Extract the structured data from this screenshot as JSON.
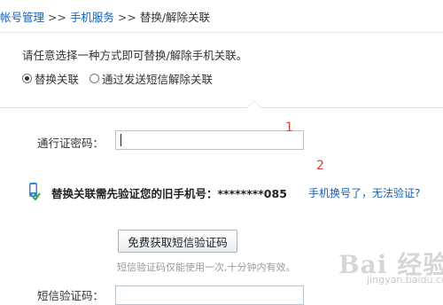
{
  "breadcrumb": {
    "item1": "帐号管理",
    "sep1": " >> ",
    "item2": "手机服务",
    "sep2": " >> ",
    "current": "替换/解除关联"
  },
  "intro": "请任意选择一种方式即可替换/解除手机关联。",
  "options": [
    {
      "label": "替换关联",
      "checked": true
    },
    {
      "label": "通过发送短信解除关联",
      "checked": false
    }
  ],
  "form": {
    "password_label": "通行证密码：",
    "password_value": "",
    "verify_prefix": "替换关联需先验证您的旧手机号：",
    "verify_number": "********085",
    "changed_link": "手机换号了，无法验证?",
    "sms_button": "免费获取短信验证码",
    "sms_hint": "短信验证码仅能使用一次,十分钟内有效。",
    "code_label": "短信验证码："
  },
  "annotations": [
    "1",
    "2"
  ],
  "watermark": {
    "text": "Bai 经验",
    "sub": "jingyan.baidu.com"
  },
  "colors": {
    "link": "#1a5fb4",
    "annotation": "#e23b3b",
    "icon": "#2e8ad8"
  },
  "icons": [
    "phone-check-icon"
  ]
}
